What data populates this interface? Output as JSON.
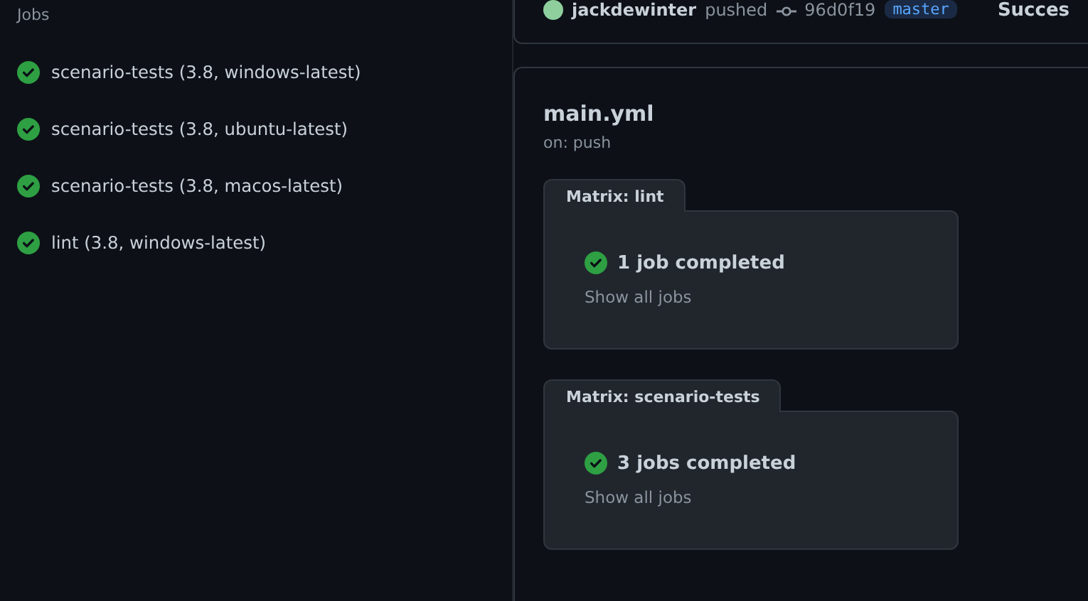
{
  "sidebar": {
    "heading": "Jobs",
    "jobs": [
      {
        "name": "scenario-tests (3.8, windows-latest)",
        "succeeded": true
      },
      {
        "name": "scenario-tests (3.8, ubuntu-latest)",
        "succeeded": true
      },
      {
        "name": "scenario-tests (3.8, macos-latest)",
        "succeeded": true
      },
      {
        "name": "lint (3.8, windows-latest)",
        "succeeded": true
      }
    ]
  },
  "summary": {
    "actor": "jackdewinter",
    "action": "pushed",
    "commit": "96d0f19",
    "branch": "master",
    "status": "Succes"
  },
  "workflow": {
    "file": "main.yml",
    "trigger": "on: push",
    "matrices": [
      {
        "title": "Matrix: lint",
        "succeeded": true,
        "result": "1 job completed",
        "link": "Show all jobs"
      },
      {
        "title": "Matrix: scenario-tests",
        "succeeded": true,
        "result": "3 jobs completed",
        "link": "Show all jobs"
      }
    ]
  }
}
